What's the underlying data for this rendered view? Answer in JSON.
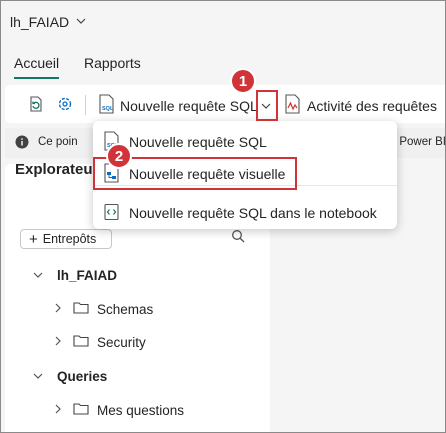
{
  "workspace": {
    "title": "lh_FAIAD"
  },
  "tabs": [
    {
      "label": "Accueil",
      "active": true
    },
    {
      "label": "Rapports",
      "active": false
    }
  ],
  "ribbon": {
    "new_sql_label": "Nouvelle requête SQL",
    "activity_label": "Activité des requêtes"
  },
  "info_bar": {
    "text": "Ce poin",
    "right_text": "Power BI"
  },
  "dropdown": {
    "items": [
      {
        "label": "Nouvelle requête SQL",
        "icon": "sql-query-icon"
      },
      {
        "label": "Nouvelle requête visuelle",
        "icon": "visual-query-icon",
        "highlighted": true
      },
      {
        "label": "Nouvelle requête SQL dans le notebook",
        "icon": "notebook-icon"
      }
    ]
  },
  "explorer": {
    "title": "Explorateu",
    "warehouses_button": "Entrepôts",
    "tree": [
      {
        "label": "lh_FAIAD",
        "expanded": true,
        "level": 0,
        "bold": true
      },
      {
        "label": "Schemas",
        "expanded": false,
        "level": 1,
        "folder": true
      },
      {
        "label": "Security",
        "expanded": false,
        "level": 1,
        "folder": true
      },
      {
        "label": "Queries",
        "expanded": true,
        "level": 0,
        "bold": true
      },
      {
        "label": "Mes questions",
        "expanded": false,
        "level": 1,
        "folder": true
      }
    ]
  },
  "annotations": {
    "badge1": "1",
    "badge2": "2",
    "accent_color": "#d13438"
  }
}
